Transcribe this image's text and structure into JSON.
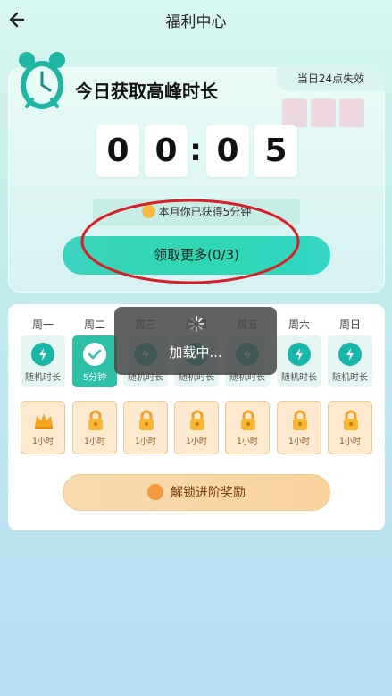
{
  "header": {
    "title": "福利中心"
  },
  "peak_card": {
    "title": "今日获取高峰时长",
    "expire_note": "当日24点失效",
    "timer_digits": [
      "0",
      "0",
      "0",
      "5"
    ],
    "timer_separator": ":",
    "earned_text": "本月你已获得5分钟",
    "claim_button": "领取更多(0/3)"
  },
  "week": {
    "days": [
      {
        "label": "周一",
        "tile_text": "随机时长",
        "active": false
      },
      {
        "label": "周二",
        "tile_text": "5分钟",
        "active": true
      },
      {
        "label": "周三",
        "tile_text": "随机时长",
        "active": false
      },
      {
        "label": "周四",
        "tile_text": "随机时长",
        "active": false
      },
      {
        "label": "周五",
        "tile_text": "随机时长",
        "active": false
      },
      {
        "label": "周六",
        "tile_text": "随机时长",
        "active": false
      },
      {
        "label": "周日",
        "tile_text": "随机时长",
        "active": false
      }
    ],
    "lock_rewards": [
      "1小时",
      "1小时",
      "1小时",
      "1小时",
      "1小时",
      "1小时",
      "1小时"
    ],
    "unlock_button": "解锁进阶奖励"
  },
  "toast": {
    "message": "加载中..."
  },
  "colors": {
    "accent": "#2ed7b1",
    "active_tile": "#2dbfa8",
    "lock_bg": "#fde9cf",
    "annotation": "#d81f26"
  }
}
